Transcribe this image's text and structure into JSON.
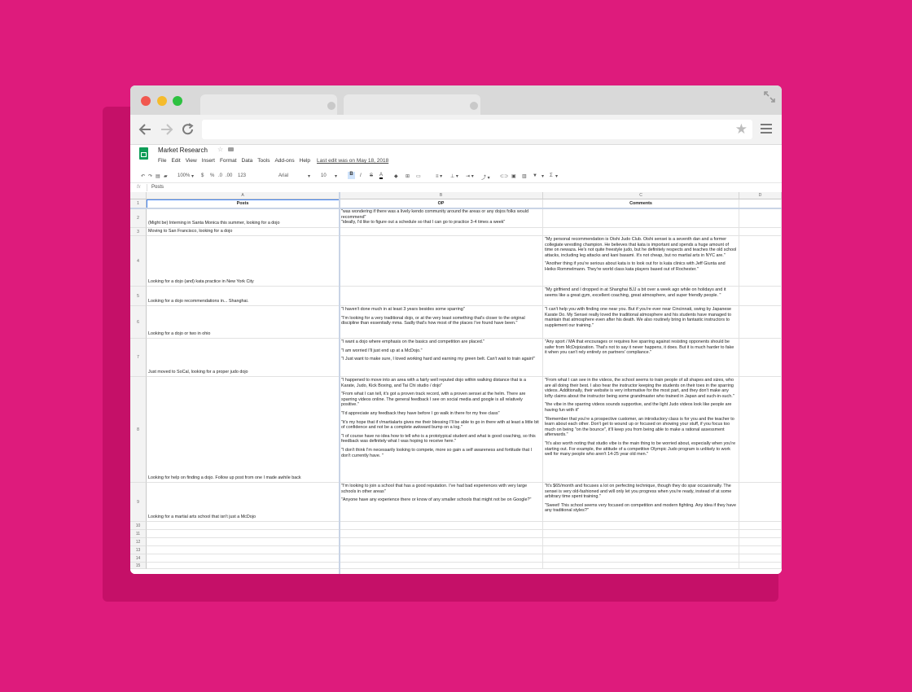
{
  "browser": {
    "star": "★"
  },
  "sheet": {
    "title": "Market Research",
    "menus": [
      "File",
      "Edit",
      "View",
      "Insert",
      "Format",
      "Data",
      "Tools",
      "Add-ons",
      "Help"
    ],
    "last_edit": "Last edit was on May 18, 2018",
    "toolbar": {
      "zoom": "100%",
      "currency": "$",
      "percent": "%",
      "dec_less": ".0",
      "dec_more": ".00",
      "format_more": "123",
      "font": "Arial",
      "size": "10",
      "bold": "B",
      "italic": "I",
      "strike": "S",
      "textcolor": "A",
      "sigma": "Σ"
    },
    "fx_label": "fx",
    "fx_value": "Posts",
    "col_letters": [
      "A",
      "B",
      "C",
      "D"
    ],
    "headers": {
      "a": "Posts",
      "b": "OP",
      "c": "Comments"
    },
    "rows": [
      {
        "n": "2",
        "a": "(Might be) Interning in Santa Monica this summer, looking for a dojo",
        "b": [
          "\"was wondering if there was a lively kendo community around the areas or any dojos folks would recommend\"\n\"ideally, I'd like to figure out a schedule so that I can go to practice 3-4 times a week\""
        ],
        "c": []
      },
      {
        "n": "3",
        "a": "Moving to San Francisco, looking for a dojo",
        "b": [],
        "c": []
      },
      {
        "n": "4",
        "a": "Looking for a dojo (and) kata practice in New York City",
        "b": [],
        "c": [
          "\"My personal recommendation is Oishi Judo Club. Oishi sensei is a seventh dan and a former collegiate wrestling champion. He believes that kata is important and spends a huge amount of time on newaza. He's not quite freestyle judo, but he definitely respects and teaches the old school attacks, including leg attacks and kani basami. It's not cheap, but no martial arts in NYC are.\"",
          "\"Another thing if you're serious about kata is to look out for is kata clinics with Jeff Giunta and Heiko Rommelmann. They're world class kata players based out of Rochester.\""
        ]
      },
      {
        "n": "5",
        "a": "Looking for a dojo recommendations in... Shanghai.",
        "b": [],
        "c": [
          "\"My girlfriend and I dropped in at Shanghai BJJ a bit over a week ago while on holidays and it seems like a great gym, excellent coaching, great atmosphere, and super friendly people. \""
        ]
      },
      {
        "n": "6",
        "a": "Looking for a dojo or two in ohio",
        "b": [
          "\"I haven't done much in at least 3 years besides some sparring\"",
          "\"I'm looking for a very traditional dojo, or at the very least something that's closer to the original discipline than essentially mma. Sadly that's how most of the places I've found have been.\""
        ],
        "c": [
          "\"I can't help you with finding one near you. But if you're ever near Cincinnati, swing by Japanese Karate Do. My Sensei really loved the traditional atmosphere and his students have managed to maintain that atmosphere even after his death. We also routinely bring in fantastic instructors to supplement our training.\""
        ]
      },
      {
        "n": "7",
        "a": "Just moved to SoCal, looking for a proper judo dojo",
        "b": [
          "\"I want a dojo where emphasis on the basics and competition are placed.\"",
          "\"I am worried I'll just end up at a McDojo.\"",
          "\"I Just want to make sure, I loved working hard and earning my green belt. Can't wait to train again!\""
        ],
        "c": [
          "\"Any sport / MA that encourages or requires live sparring against resisting opponents should be safer from McDojoization. That's not to say it never happens, it does. But it is much harder to fake it when you can't rely entirely on partners' compliance.\""
        ]
      },
      {
        "n": "8",
        "a": "Looking for help on finding a dojo. Follow up post from one I made awhile back",
        "b": [
          "\"I happened to move into an area with a fairly well reputed dojo within walking distance that is a Karate, Judo, Kick Boxing, and Tai Chi studio / dojo\"",
          "\"From what I can tell, it's got a proven track record, with a proven sensei at the helm. There are sparring videos online. The general feedback I see on social media and google is all relatively positive.\"",
          "\"I'd appreciate any feedback they have before I go walk in there for my free class\"",
          "\"it's my hope that if r/martialarts gives me their blessing I'll be able to go in there with at least a little bit of confidence and not be a complete awkward bump on a log.\"",
          "\"I of course have no idea how to tell who is a prototypical student and what is good coaching, so this feedback was definitely what I was hoping to receive here.\"",
          "\"I don't think I'm necessarily looking to compete, more so gain a self awareness and fortitude that I don't currently have. \""
        ],
        "c": [
          "\"From what I can see in the videos, the school seems to train people of all shapes and sizes, who are all doing their best. I also hear the instructor keeping the students on their toes in the sparring videos. Additionally, their website is very informative for the most part, and they don't make any lofty claims about the instructor being some grandmaster who trained in Japan and such-in-such.\"",
          "\"the vibe in the sparring videos sounds supportive, and the light Judo videos look like people are having fun with it\"",
          "\"Remember that you're a prospective customer, an introductory class is for you and the teacher to learn about each other. Don't get to wound up or focused on showing your stuff, if you focus too much on being \"on the bounce\", it'll keep you from being able to make a rational assessment afterwards.\"",
          "\"It's also worth noting that studio vibe is the main thing to be worried about, especially when you're starting out. For example, the attitude of a competitive Olympic Judo program is unlikely to work well for many people who aren't 14-25 year old men.\""
        ]
      },
      {
        "n": "9",
        "a": "Looking for a martial arts school that isn't just a McDojo",
        "b": [
          "\"I'm looking to join a school that has a good reputation. I've had bad experiences with very large schools in other areas\"",
          "\"Anyone have any experience there or know of any smaller schools that might not be on Google?\""
        ],
        "c": [
          "\"It's $65/month and focuses a lot on perfecting technique, though they do spar occasionally. The sensei is very old-fashioned and will only let you progress when you're ready, instead of at some arbitrary time spent training.\"",
          "\"Sweet! This school seems very focused on competition and modern fighting. Any idea if they have any traditional styles?\""
        ]
      },
      {
        "n": "10",
        "a": "",
        "b": [],
        "c": []
      },
      {
        "n": "11",
        "a": "",
        "b": [],
        "c": []
      },
      {
        "n": "12",
        "a": "",
        "b": [],
        "c": []
      },
      {
        "n": "13",
        "a": "",
        "b": [],
        "c": []
      },
      {
        "n": "14",
        "a": "",
        "b": [],
        "c": []
      },
      {
        "n": "15",
        "a": "",
        "b": [],
        "c": []
      }
    ]
  },
  "colors": {
    "background": "#de1b7c",
    "sheets_green": "#0f9d58",
    "selection": "#4285f4"
  }
}
